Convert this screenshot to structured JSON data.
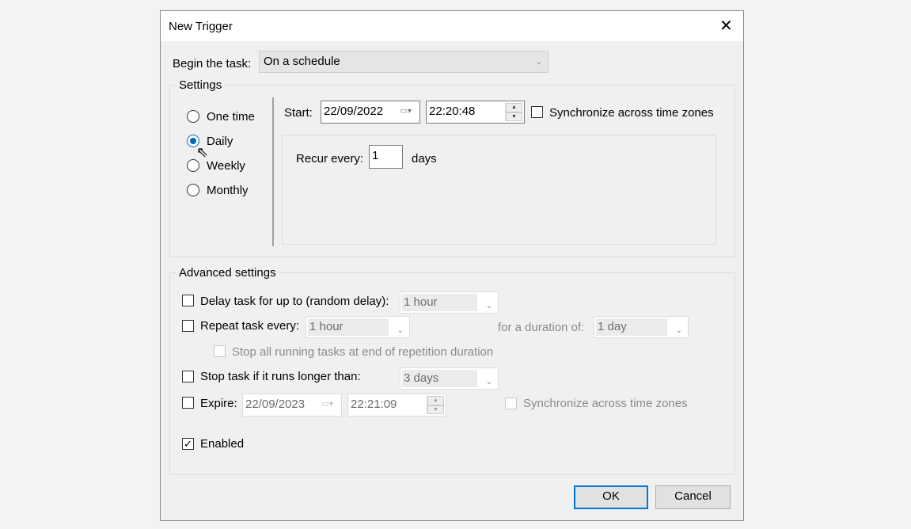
{
  "title": "New Trigger",
  "begin_label": "Begin the task:",
  "begin_value": "On a schedule",
  "settings": {
    "title": "Settings",
    "radios": [
      "One time",
      "Daily",
      "Weekly",
      "Monthly"
    ],
    "selected": "Daily",
    "start_label": "Start:",
    "start_date": "22/09/2022",
    "start_time": "22:20:48",
    "sync_label": "Synchronize across time zones",
    "recur_label": "Recur every:",
    "recur_value": "1",
    "recur_unit": "days"
  },
  "advanced": {
    "title": "Advanced settings",
    "delay_label": "Delay task for up to (random delay):",
    "delay_value": "1 hour",
    "repeat_label": "Repeat task every:",
    "repeat_value": "1 hour",
    "duration_label": "for a duration of:",
    "duration_value": "1 day",
    "stop_all_label": "Stop all running tasks at end of repetition duration",
    "stop_label": "Stop task if it runs longer than:",
    "stop_value": "3 days",
    "expire_label": "Expire:",
    "expire_date": "22/09/2023",
    "expire_time": "22:21:09",
    "expire_sync_label": "Synchronize across time zones",
    "enabled_label": "Enabled",
    "enabled": true
  },
  "buttons": {
    "ok": "OK",
    "cancel": "Cancel"
  },
  "accent": "#0067c0"
}
